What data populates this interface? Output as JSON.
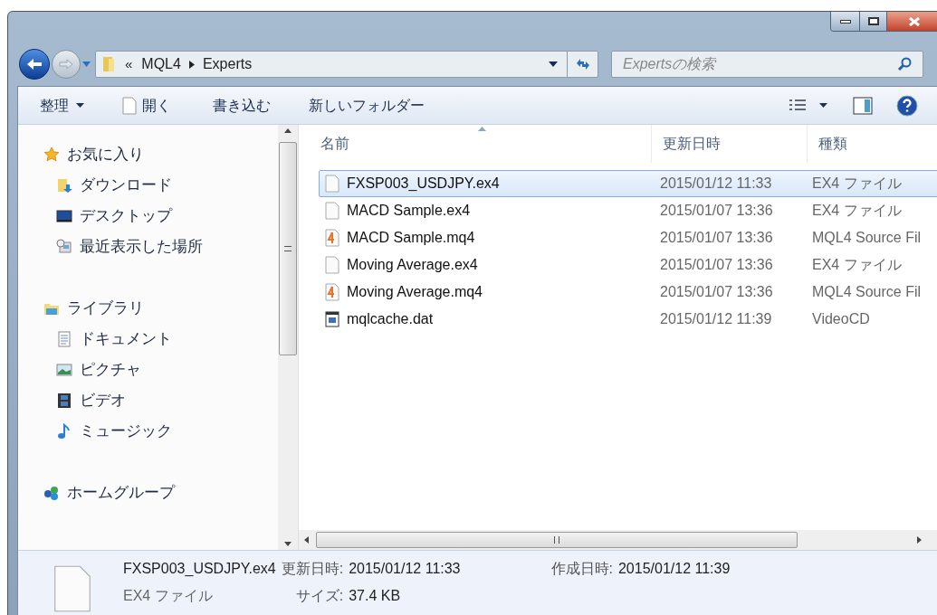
{
  "address": {
    "overflow": "«",
    "crumbs": [
      "MQL4",
      "Experts"
    ]
  },
  "search": {
    "placeholder": "Expertsの検索"
  },
  "toolbar": {
    "organize": "整理",
    "open": "開く",
    "burn": "書き込む",
    "new_folder": "新しいフォルダー"
  },
  "sidebar": {
    "groups": [
      {
        "label": "お気に入り",
        "kind": "star",
        "children": [
          {
            "label": "ダウンロード",
            "kind": "download"
          },
          {
            "label": "デスクトップ",
            "kind": "desktop"
          },
          {
            "label": "最近表示した場所",
            "kind": "recent"
          }
        ]
      },
      {
        "label": "ライブラリ",
        "kind": "library",
        "children": [
          {
            "label": "ドキュメント",
            "kind": "document"
          },
          {
            "label": "ピクチャ",
            "kind": "picture"
          },
          {
            "label": "ビデオ",
            "kind": "video"
          },
          {
            "label": "ミュージック",
            "kind": "music"
          }
        ]
      },
      {
        "label": "ホームグループ",
        "kind": "homegroup"
      }
    ]
  },
  "table": {
    "columns": [
      "名前",
      "更新日時",
      "種類"
    ],
    "rows": [
      {
        "name": "FXSP003_USDJPY.ex4",
        "date": "2015/01/12 11:33",
        "type": "EX4 ファイル",
        "kind": "blank",
        "selected": true
      },
      {
        "name": "MACD Sample.ex4",
        "date": "2015/01/07 13:36",
        "type": "EX4 ファイル",
        "kind": "blank",
        "selected": false
      },
      {
        "name": "MACD Sample.mq4",
        "date": "2015/01/07 13:36",
        "type": "MQL4 Source Fil",
        "kind": "mq4",
        "selected": false
      },
      {
        "name": "Moving Average.ex4",
        "date": "2015/01/07 13:36",
        "type": "EX4 ファイル",
        "kind": "blank",
        "selected": false
      },
      {
        "name": "Moving Average.mq4",
        "date": "2015/01/07 13:36",
        "type": "MQL4 Source Fil",
        "kind": "mq4",
        "selected": false
      },
      {
        "name": "mqlcache.dat",
        "date": "2015/01/12 11:39",
        "type": "VideoCD",
        "kind": "dat",
        "selected": false
      }
    ]
  },
  "details": {
    "name": "FXSP003_USDJPY.ex4",
    "type": "EX4 ファイル",
    "modified_label": "更新日時:",
    "modified": "2015/01/12 11:33",
    "size_label": "サイズ:",
    "size": "37.4 KB",
    "created_label": "作成日時:",
    "created": "2015/01/12 11:39"
  }
}
